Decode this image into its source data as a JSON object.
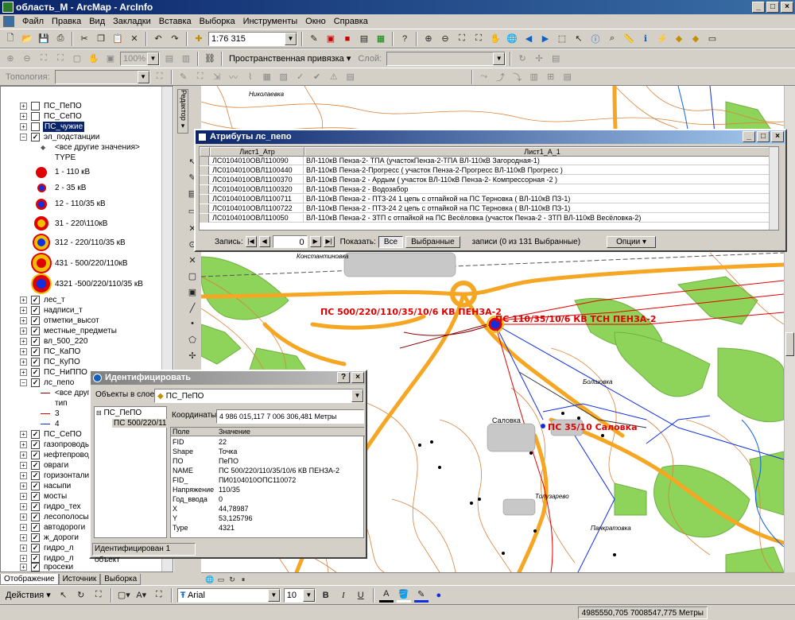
{
  "window": {
    "title": "область_М - ArcMap - ArcInfo"
  },
  "menu": [
    "Файл",
    "Правка",
    "Вид",
    "Закладки",
    "Вставка",
    "Выборка",
    "Инструменты",
    "Окно",
    "Справка"
  ],
  "toolbar": {
    "scale": "1:76 315",
    "zoom_pct": "100%",
    "snapping_label": "Пространственная привязка ▾",
    "layer_label": "Слой:",
    "topology_label": "Топология:"
  },
  "toc": {
    "layers": [
      {
        "name": "ПС_ПеПО",
        "checked": false,
        "expanded": false
      },
      {
        "name": "ПС_СеПО",
        "checked": false,
        "expanded": false
      },
      {
        "name": "ПС_чужие",
        "checked": false,
        "expanded": false,
        "selected": true
      },
      {
        "name": "эл_подстанции",
        "checked": true,
        "expanded": true
      }
    ],
    "legend_other": "<все другие значения>",
    "legend_type": "TYPE",
    "legend_items": [
      "1 - 110 кВ",
      "2 - 35 кВ",
      "12 - 110/35 кВ",
      "31 - 220\\110кВ",
      "312 - 220/110/35 кВ",
      "431 - 500/220/110кВ",
      "4321 -500/220/110/35 кВ"
    ],
    "layers2": [
      "лес_т",
      "надписи_т",
      "отметки_высот",
      "местные_предметы",
      "вл_500_220",
      "ПС_КаПО",
      "ПС_КуПО",
      "ПС_НиППО",
      "лс_пепо"
    ],
    "lspepo_legend": [
      "<все други",
      "тип",
      "3",
      "4"
    ],
    "layers3": [
      "ПС_СеПО",
      "газопроводы",
      "нефтепроводы",
      "овраги",
      "горизонтали",
      "насыпи",
      "мосты",
      "гидро_тех",
      "лесополосы",
      "автодороги",
      "ж_дороги",
      "гидро_л",
      "гидро_л",
      "просеки"
    ],
    "tabs": [
      "Отображение",
      "Источник",
      "Выборка"
    ]
  },
  "editor": {
    "label": "Редактор ▾"
  },
  "attr": {
    "title": "Атрибуты лс_пепо",
    "col1": "Лист1_Атр",
    "col2": "Лист1_А_1",
    "rows": [
      [
        "ЛС0104010ОВЛ110090",
        "ВЛ-110кВ Пенза-2- ТПА (участокПенза-2-ТПА ВЛ-110кВ Загородная-1)"
      ],
      [
        "ЛС0104010ОВЛ1100440",
        "ВЛ-110кВ Пенза-2-Прогресс ( участок Пенза-2-Прогресс ВЛ-110кВ Прогресс )"
      ],
      [
        "ЛС0104010ОВЛ1100370",
        "ВЛ-110кВ Пенза-2 - Ардым ( участок ВЛ-110кВ Пенза-2- Компрессорная -2 )"
      ],
      [
        "ЛС0104010ОВЛ1100320",
        "ВЛ-110кВ Пенза-2 - Водозабор"
      ],
      [
        "ЛС0104010ОВЛ1100711",
        "ВЛ-110кВ Пенза-2 - ПТЗ-24 1 цепь с отпайкой на ПС Терновка ( ВЛ-110кВ ПЗ-1)"
      ],
      [
        "ЛС0104010ОВЛ1100722",
        "ВЛ-110кВ Пенза-2 - ПТЗ-24 2 цепь с отпайкой на ПС Терновка ( ВЛ-110кВ ПЗ-1)"
      ],
      [
        "ЛС0104010ОВЛ110050",
        "ВЛ-110кВ Пенза-2 - ЗТП с отпайкой на ПС Весёловка (участок Пенза-2 - ЗТП ВЛ-110кВ Весёловка-2)"
      ]
    ],
    "record_label": "Запись:",
    "record_value": "0",
    "show_label": "Показать:",
    "all_btn": "Все",
    "selected_btn": "Выбранные",
    "count_text": "записи (0 из 131 Выбранные)",
    "options_btn": "Опции ▾"
  },
  "ident": {
    "title": "Идентифицировать",
    "layer_label": "Объекты в слое:",
    "layer_value": "ПС_ПеПО",
    "tree_root": "ПС_ПеПО",
    "tree_child": "ПС 500/220/11",
    "coords_label": "Координаты:",
    "coords_value": "4 986 015,117  7 006 306,481 Метры",
    "col_field": "Поле",
    "col_value": "Значение",
    "fields": [
      [
        "FID",
        "22"
      ],
      [
        "Shape",
        "Точка"
      ],
      [
        "ПО",
        "ПеПО"
      ],
      [
        "NAME",
        "ПС 500/220/110/35/10/6 КВ ПЕНЗА-2"
      ],
      [
        "FID_",
        "ПИ0104010ОПС110072"
      ],
      [
        "Напряжение",
        "110/35"
      ],
      [
        "Год_ввода",
        "0"
      ],
      [
        "X",
        "44,78987"
      ],
      [
        "Y",
        "53,125796"
      ],
      [
        "Type",
        "4321"
      ]
    ],
    "status": "Идентифицирован 1 объект"
  },
  "map_labels": {
    "penza2": "ПС 500/220/110/35/10/6 КВ ПЕНЗА-2",
    "tsn": "ПС 110/35/10/6 КВ ТСН ПЕНЗА-2",
    "salovka": "ПС 35/10 Саловка",
    "nikolaevka": "Николаевка",
    "konst": "Константиновка",
    "salovka_town": "Саловка",
    "bolshovka": "Болшовка",
    "tolubaevo": "Толузарево",
    "pankrat": "Панкратовка"
  },
  "draw": {
    "actions": "Действия ▾",
    "font": "Arial",
    "size": "10"
  },
  "status": {
    "coords": "4985550,705  7008547,775 Метры"
  },
  "colors": {
    "title_bar": "#0a246a",
    "road": "#f5a623",
    "forest": "#8ed35a",
    "contour": "#d9823b",
    "station": "#e00000"
  }
}
